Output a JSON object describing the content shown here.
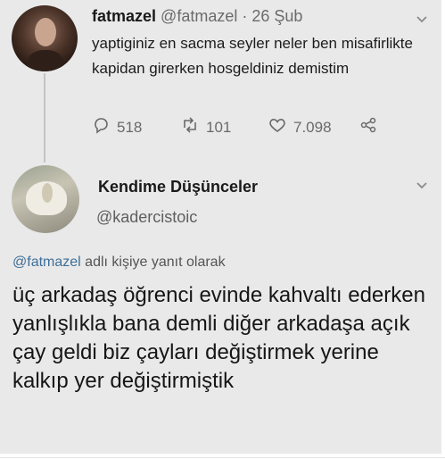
{
  "tweet1": {
    "name": "fatmazel",
    "handle": "@fatmazel",
    "date": "· 26 Şub",
    "text": "yaptiginiz en sacma seyler neler ben misafirlikte kapidan girerken hosgeldiniz demistim",
    "replies": "518",
    "retweets": "101",
    "likes": "7.098",
    "icons": {
      "reply": "reply-bubble-icon",
      "retweet": "retweet-icon",
      "like": "heart-icon",
      "share": "share-icon",
      "menu": "chevron-down-icon"
    }
  },
  "tweet2": {
    "name": "Kendime Düşünceler",
    "handle": "@kadercistoic",
    "reply_mention": "@fatmazel",
    "reply_suffix": " adlı kişiye yanıt olarak",
    "text": "üç arkadaş öğrenci evinde kahvaltı ederken yanlışlıkla bana demli diğer arkadaşa açık çay geldi biz çayları değiştirmek yerine kalkıp yer değiştirmiştik"
  },
  "colors": {
    "background": "#e9e9e9",
    "text": "#1a1a1a",
    "muted": "#6b6b6b",
    "mention": "#3d6f99"
  }
}
